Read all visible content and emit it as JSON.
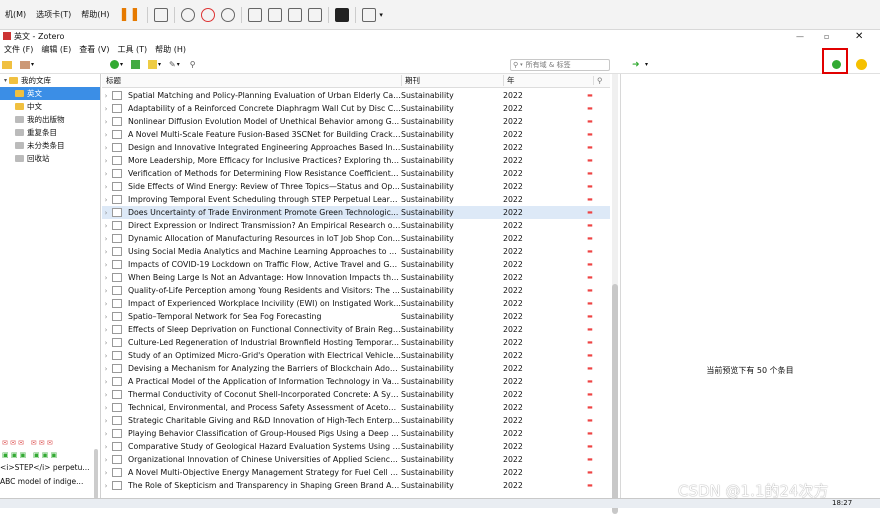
{
  "outer_menu": [
    "机(M)",
    "选项卡(T)",
    "帮助(H)"
  ],
  "zotero": {
    "window_title": "英文 - Zotero",
    "menu": [
      "文件 (F)",
      "编辑 (E)",
      "查看 (V)",
      "工具 (T)",
      "帮助 (H)"
    ],
    "search_placeholder": "所有域 & 标签",
    "columns": {
      "title": "标题",
      "publication": "期刊",
      "year": "年"
    },
    "collections": [
      {
        "label": "我的文库",
        "selected": false
      },
      {
        "label": "英文",
        "selected": true
      },
      {
        "label": "中文",
        "selected": false
      },
      {
        "label": "我的出版物",
        "selected": false
      },
      {
        "label": "重复条目",
        "selected": false
      },
      {
        "label": "未分类条目",
        "selected": false
      },
      {
        "label": "回收站",
        "selected": false
      }
    ],
    "left_bottom_text": [
      "<i>STEP</i> perpetu...",
      "ABC model of indige..."
    ],
    "items": [
      {
        "title": "Spatial Matching and Policy-Planning Evaluation of Urban Elderly Car...",
        "pub": "Sustainability",
        "year": "2022"
      },
      {
        "title": "Adaptability of a Reinforced Concrete Diaphragm Wall Cut by Disc C...",
        "pub": "Sustainability",
        "year": "2022"
      },
      {
        "title": "Nonlinear Diffusion Evolution Model of Unethical Behavior among G...",
        "pub": "Sustainability",
        "year": "2022"
      },
      {
        "title": "A Novel Multi-Scale Feature Fusion-Based 3SCNet for Building Crack ...",
        "pub": "Sustainability",
        "year": "2022"
      },
      {
        "title": "Design and Innovative Integrated Engineering Approaches Based Inv...",
        "pub": "Sustainability",
        "year": "2022"
      },
      {
        "title": "More Leadership, More Efficacy for Inclusive Practices? Exploring the ...",
        "pub": "Sustainability",
        "year": "2022"
      },
      {
        "title": "Verification of Methods for Determining Flow Resistance Coefficients...",
        "pub": "Sustainability",
        "year": "2022"
      },
      {
        "title": "Side Effects of Wind Energy: Review of Three Topics—Status and Op...",
        "pub": "Sustainability",
        "year": "2022"
      },
      {
        "title": "Improving Temporal Event Scheduling through STEP Perpetual Learn...",
        "pub": "Sustainability",
        "year": "2022"
      },
      {
        "title": "Does Uncertainty of Trade Environment Promote Green Technologic...",
        "pub": "Sustainability",
        "year": "2022"
      },
      {
        "title": "Direct Expression or Indirect Transmission? An Empirical Research on...",
        "pub": "Sustainability",
        "year": "2022"
      },
      {
        "title": "Dynamic Allocation of Manufacturing Resources in IoT Job Shop Con...",
        "pub": "Sustainability",
        "year": "2022"
      },
      {
        "title": "Using Social Media Analytics and Machine Learning Approaches to A...",
        "pub": "Sustainability",
        "year": "2022"
      },
      {
        "title": "Impacts of COVID-19 Lockdown on Traffic Flow, Active Travel and Ga...",
        "pub": "Sustainability",
        "year": "2022"
      },
      {
        "title": "When Being Large Is Not an Advantage: How Innovation Impacts the ...",
        "pub": "Sustainability",
        "year": "2022"
      },
      {
        "title": "Quality-of-Life Perception among Young Residents and Visitors: The ...",
        "pub": "Sustainability",
        "year": "2022"
      },
      {
        "title": "Impact of Experienced Workplace Incivility (EWI) on Instigated Work...",
        "pub": "Sustainability",
        "year": "2022"
      },
      {
        "title": "Spatio–Temporal Network for Sea Fog Forecasting",
        "pub": "Sustainability",
        "year": "2022"
      },
      {
        "title": "Effects of Sleep Deprivation on Functional Connectivity of Brain Regi...",
        "pub": "Sustainability",
        "year": "2022"
      },
      {
        "title": "Culture-Led Regeneration of Industrial Brownfield Hosting Temporar...",
        "pub": "Sustainability",
        "year": "2022"
      },
      {
        "title": "Study of an Optimized Micro-Grid's Operation with Electrical Vehicle...",
        "pub": "Sustainability",
        "year": "2022"
      },
      {
        "title": "Devising a Mechanism for Analyzing the Barriers of Blockchain Adop...",
        "pub": "Sustainability",
        "year": "2022"
      },
      {
        "title": "A Practical Model of the Application of Information Technology in Va...",
        "pub": "Sustainability",
        "year": "2022"
      },
      {
        "title": "Thermal Conductivity of Coconut Shell-Incorporated Concrete: A Sys...",
        "pub": "Sustainability",
        "year": "2022"
      },
      {
        "title": "Technical, Environmental, and Process Safety Assessment of Acetone...",
        "pub": "Sustainability",
        "year": "2022"
      },
      {
        "title": "Strategic Charitable Giving and R&D Innovation of High-Tech Enterp...",
        "pub": "Sustainability",
        "year": "2022"
      },
      {
        "title": "Playing Behavior Classification of Group-Housed Pigs Using a Deep ...",
        "pub": "Sustainability",
        "year": "2022"
      },
      {
        "title": "Comparative Study of Geological Hazard Evaluation Systems Using G...",
        "pub": "Sustainability",
        "year": "2022"
      },
      {
        "title": "Organizational Innovation of Chinese Universities of Applied Science...",
        "pub": "Sustainability",
        "year": "2022"
      },
      {
        "title": "A Novel Multi-Objective Energy Management Strategy for Fuel Cell El...",
        "pub": "Sustainability",
        "year": "2022"
      },
      {
        "title": "The Role of Skepticism and Transparency in Shaping Green Brand Au...",
        "pub": "Sustainability",
        "year": "2022"
      }
    ],
    "highlighted_index": 9,
    "preview_text": "当前预览下有 50 个条目"
  },
  "watermark": "CSDN @1.1的24次方",
  "clock": "18:27",
  "accent_color": "#3b8ee6",
  "highlight_color": "#e10000"
}
